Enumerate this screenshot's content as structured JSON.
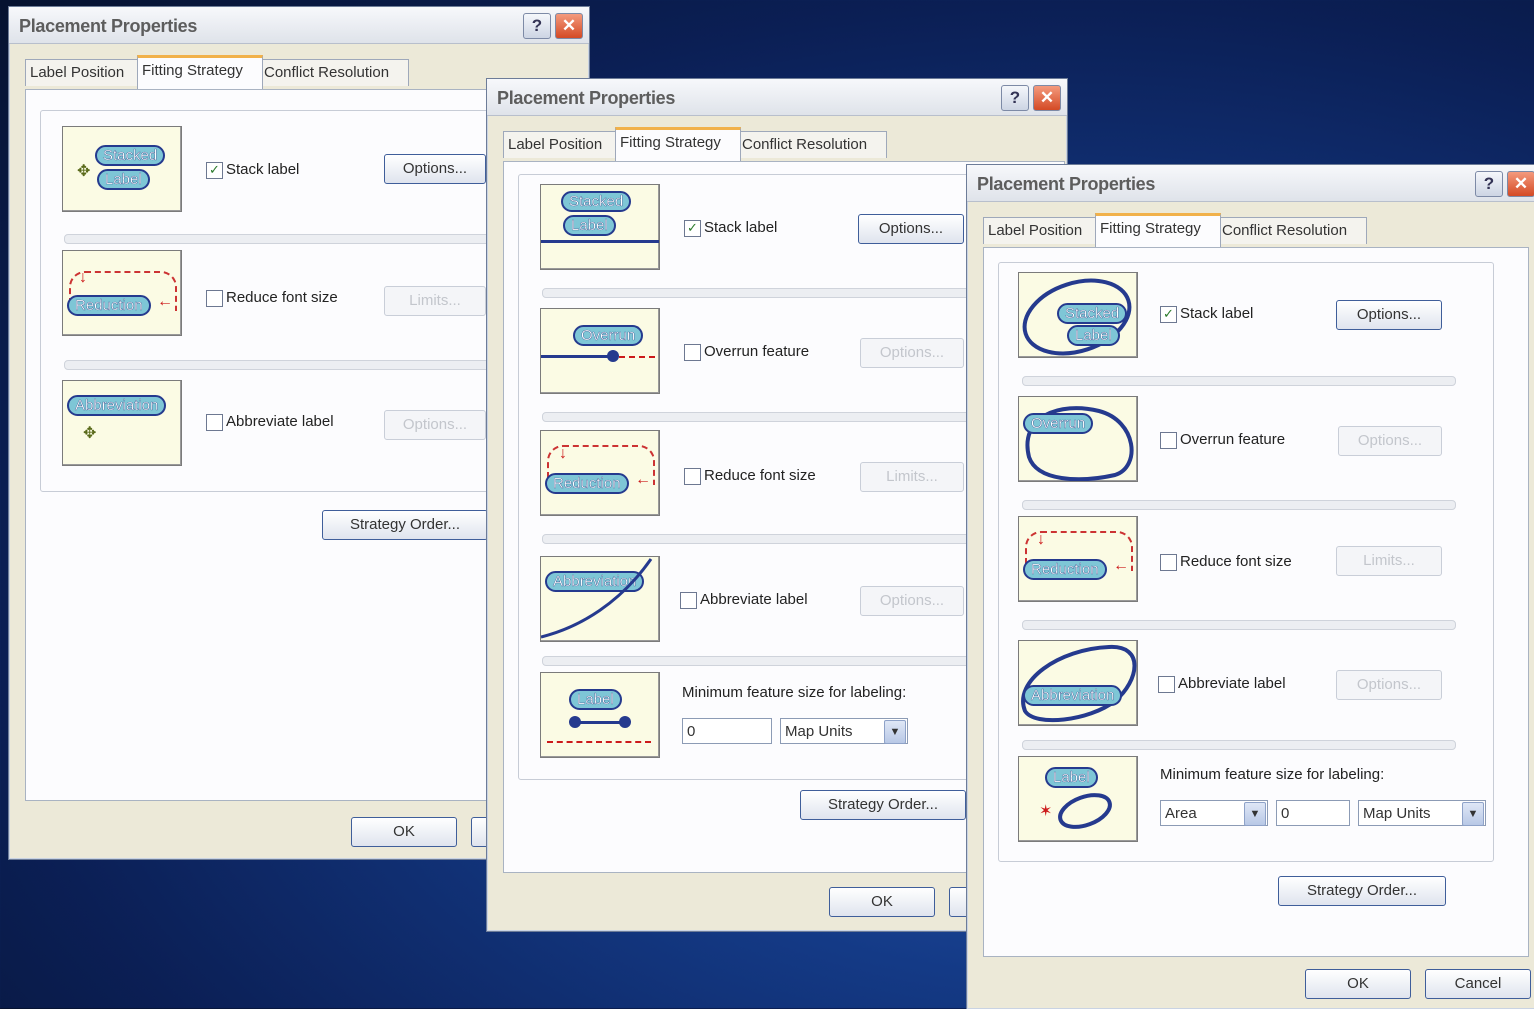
{
  "dialog": {
    "title": "Placement Properties",
    "help_glyph": "?",
    "close_glyph": "✕",
    "tabs": [
      "Label Position",
      "Fitting Strategy",
      "Conflict Resolution"
    ],
    "ok_label": "OK",
    "cancel_label": "Cancel",
    "strategy_order_label": "Strategy Order..."
  },
  "options": {
    "stack_label": "Stack label",
    "overrun_feature": "Overrun feature",
    "reduce_font_size": "Reduce font size",
    "abbreviate_label": "Abbreviate label",
    "options_btn": "Options...",
    "limits_btn": "Limits...",
    "min_feature_size": "Minimum feature size for labeling:",
    "min_value": "0",
    "units": "Map Units",
    "measure": "Area",
    "check_glyph": "✓",
    "dropdown_glyph": "▼"
  },
  "icons": {
    "stacked_line1": "Stacked",
    "stacked_line2": "Label",
    "reduction": "Reduction",
    "overrun": "Overrun",
    "abbreviation": "Abbreviation",
    "label": "Label"
  },
  "state": {
    "stack_checked": true,
    "overrun_checked": false,
    "reduce_checked": false,
    "abbreviate_checked": false
  },
  "colors": {
    "accent_tab": "#f1b14a",
    "pill_fill": "#7ec6d6",
    "feature_line": "#253a8e",
    "reduction_arrow": "#cc1a1a"
  }
}
